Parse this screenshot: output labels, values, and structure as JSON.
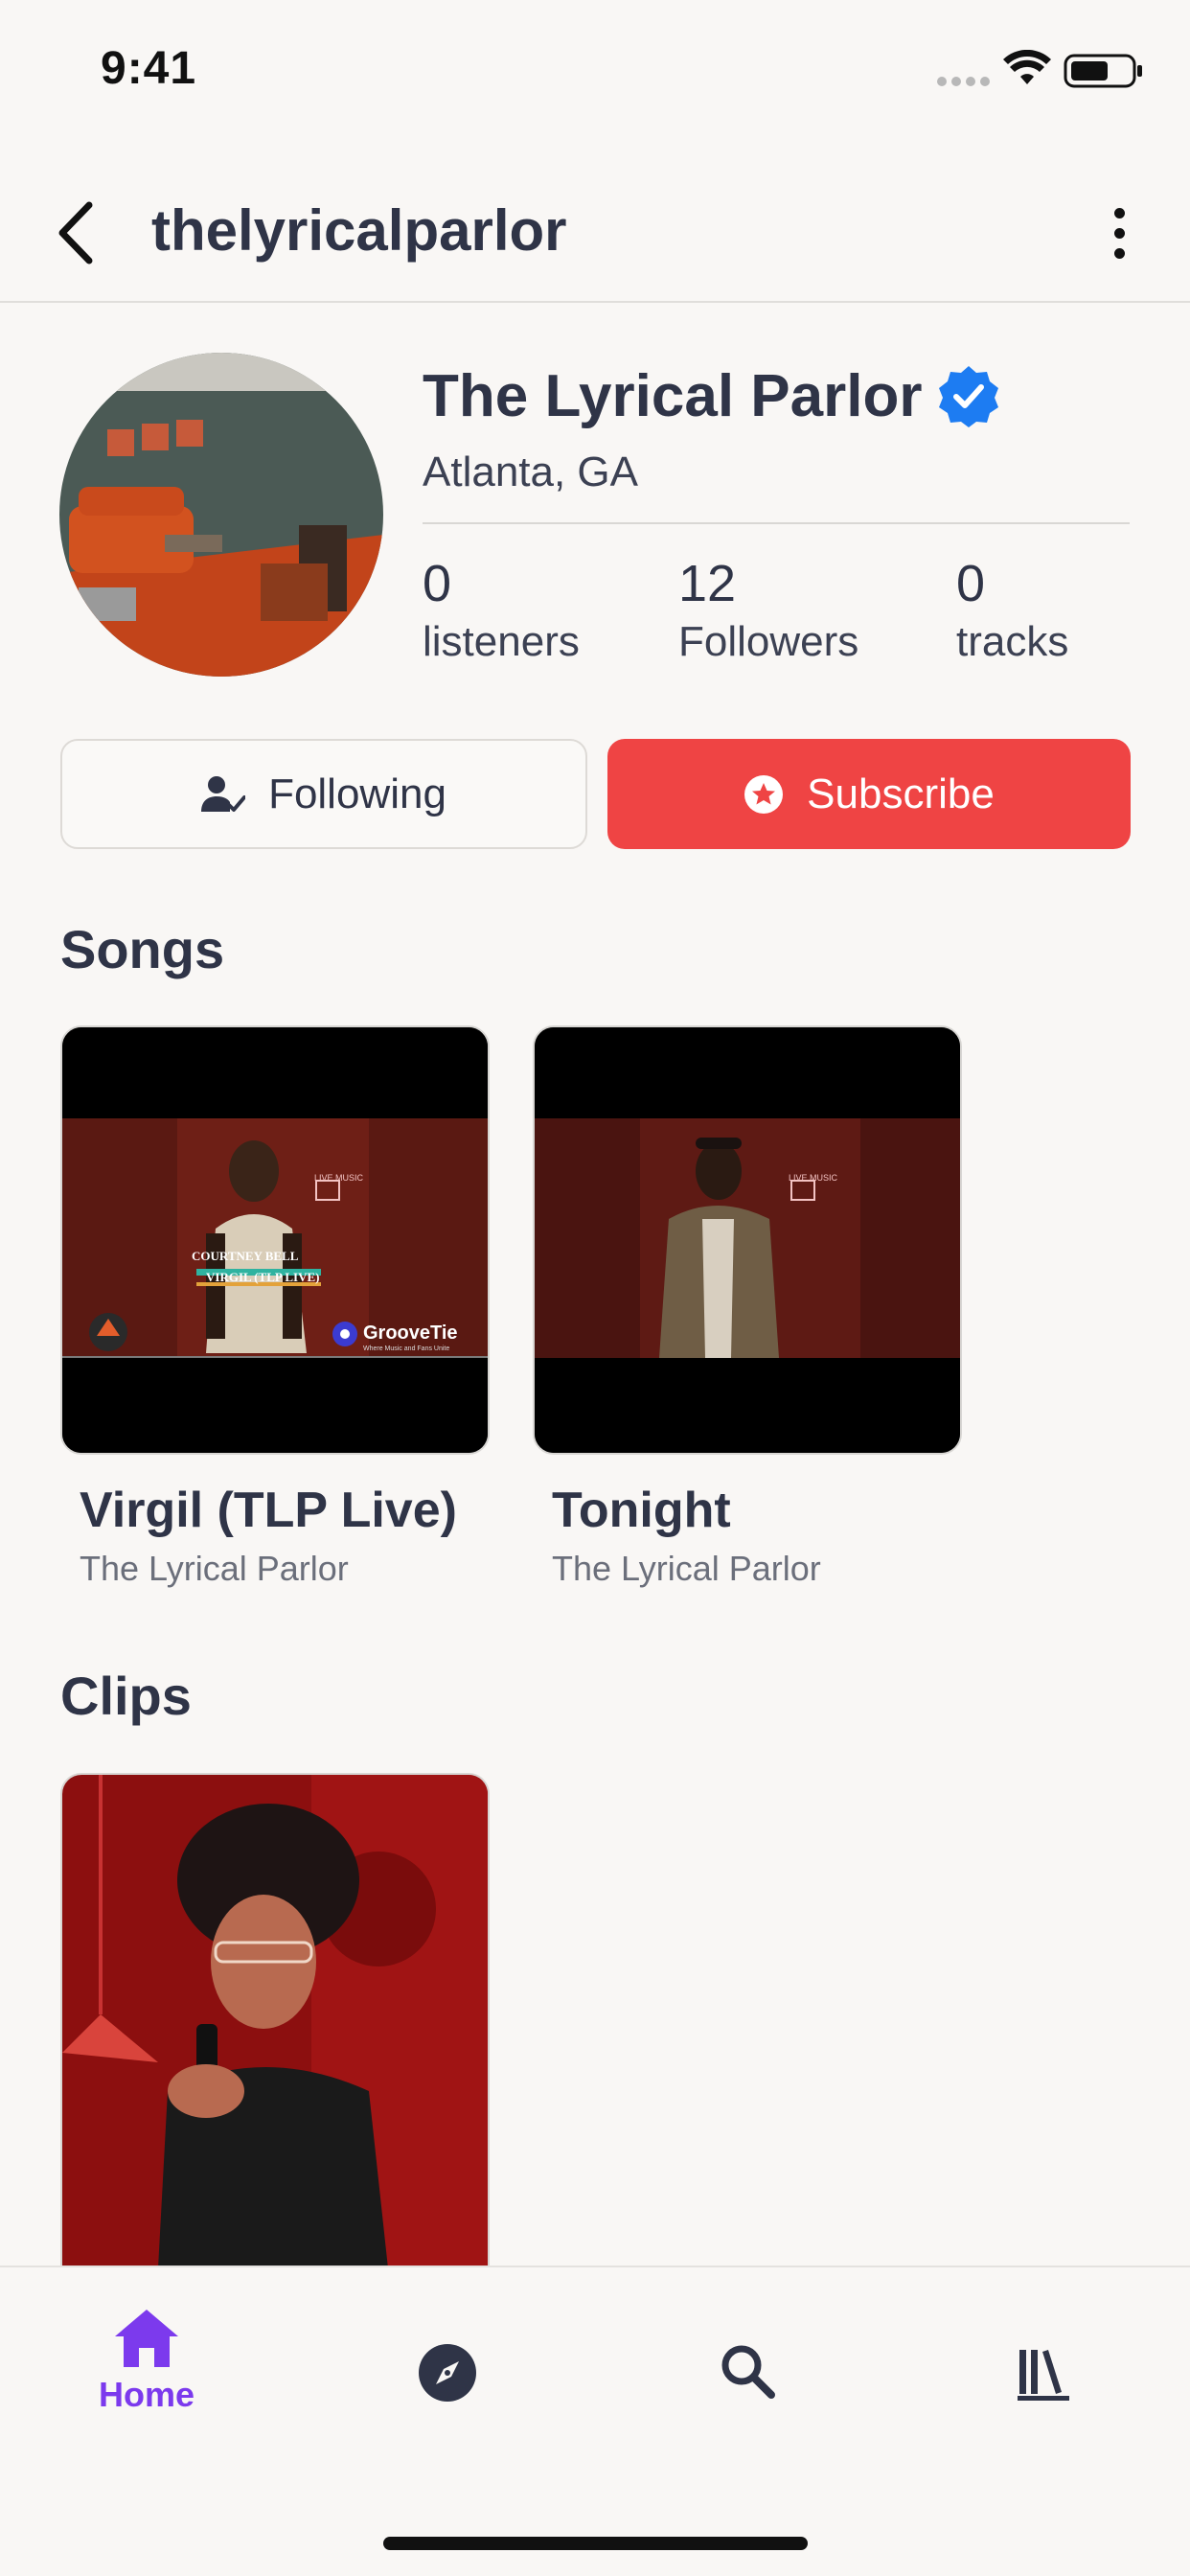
{
  "status_bar": {
    "time": "9:41"
  },
  "header": {
    "title": "thelyricalparlor"
  },
  "profile": {
    "name": "The Lyrical Parlor",
    "location": "Atlanta, GA",
    "stats": [
      {
        "value": "0",
        "label": "listeners"
      },
      {
        "value": "12",
        "label": "Followers"
      },
      {
        "value": "0",
        "label": "tracks"
      }
    ]
  },
  "actions": {
    "following_label": "Following",
    "subscribe_label": "Subscribe"
  },
  "songs": {
    "title": "Songs",
    "items": [
      {
        "title": "Virgil (TLP Live)",
        "artist": "The Lyrical Parlor",
        "overlay": {
          "name": "COURTNEY BELL",
          "track": "VIRGIL (TLP LIVE)",
          "brand": "GrooveTie",
          "tagline": "Where Music and Fans Unite",
          "live_sign": "LIVE MUSIC"
        }
      },
      {
        "title": "Tonight",
        "artist": "The Lyrical Parlor",
        "overlay": {
          "live_sign": "LIVE MUSIC"
        }
      }
    ]
  },
  "clips": {
    "title": "Clips"
  },
  "tab_bar": {
    "items": [
      {
        "icon": "home-icon",
        "label": "Home",
        "active": true
      },
      {
        "icon": "compass-icon",
        "label": "",
        "active": false
      },
      {
        "icon": "search-icon",
        "label": "",
        "active": false
      },
      {
        "icon": "library-icon",
        "label": "",
        "active": false
      }
    ]
  },
  "colors": {
    "accent": "#7c3aed",
    "subscribe": "#ef4444",
    "verified": "#1d7cf2",
    "text": "#2f3447",
    "background": "#f9f7f5"
  }
}
